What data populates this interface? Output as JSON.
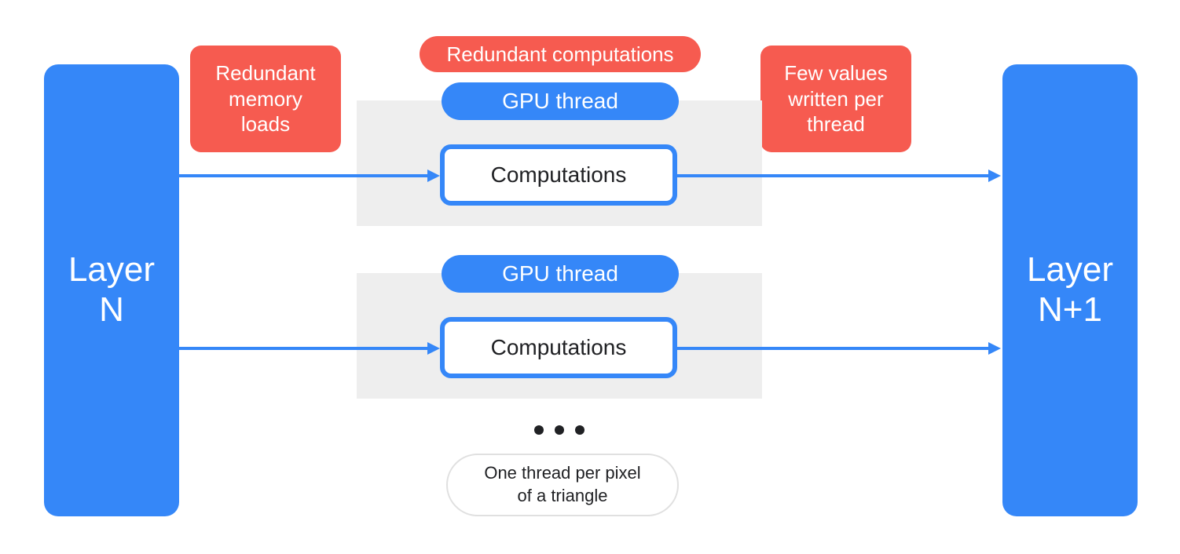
{
  "colors": {
    "blue": "#3587f8",
    "red": "#f65b50",
    "grey": "#eeeeee",
    "text": "#202124",
    "white": "#ffffff"
  },
  "layer_left_label": "Layer\nN",
  "layer_right_label": "Layer\nN+1",
  "callout_redundant_loads": "Redundant\nmemory\nloads",
  "callout_redundant_comp": "Redundant computations",
  "callout_few_values": "Few values\nwritten per\nthread",
  "threads": [
    {
      "pill": "GPU thread",
      "box": "Computations"
    },
    {
      "pill": "GPU thread",
      "box": "Computations"
    }
  ],
  "ellipsis": "...",
  "footnote": "One thread per pixel\nof a triangle"
}
